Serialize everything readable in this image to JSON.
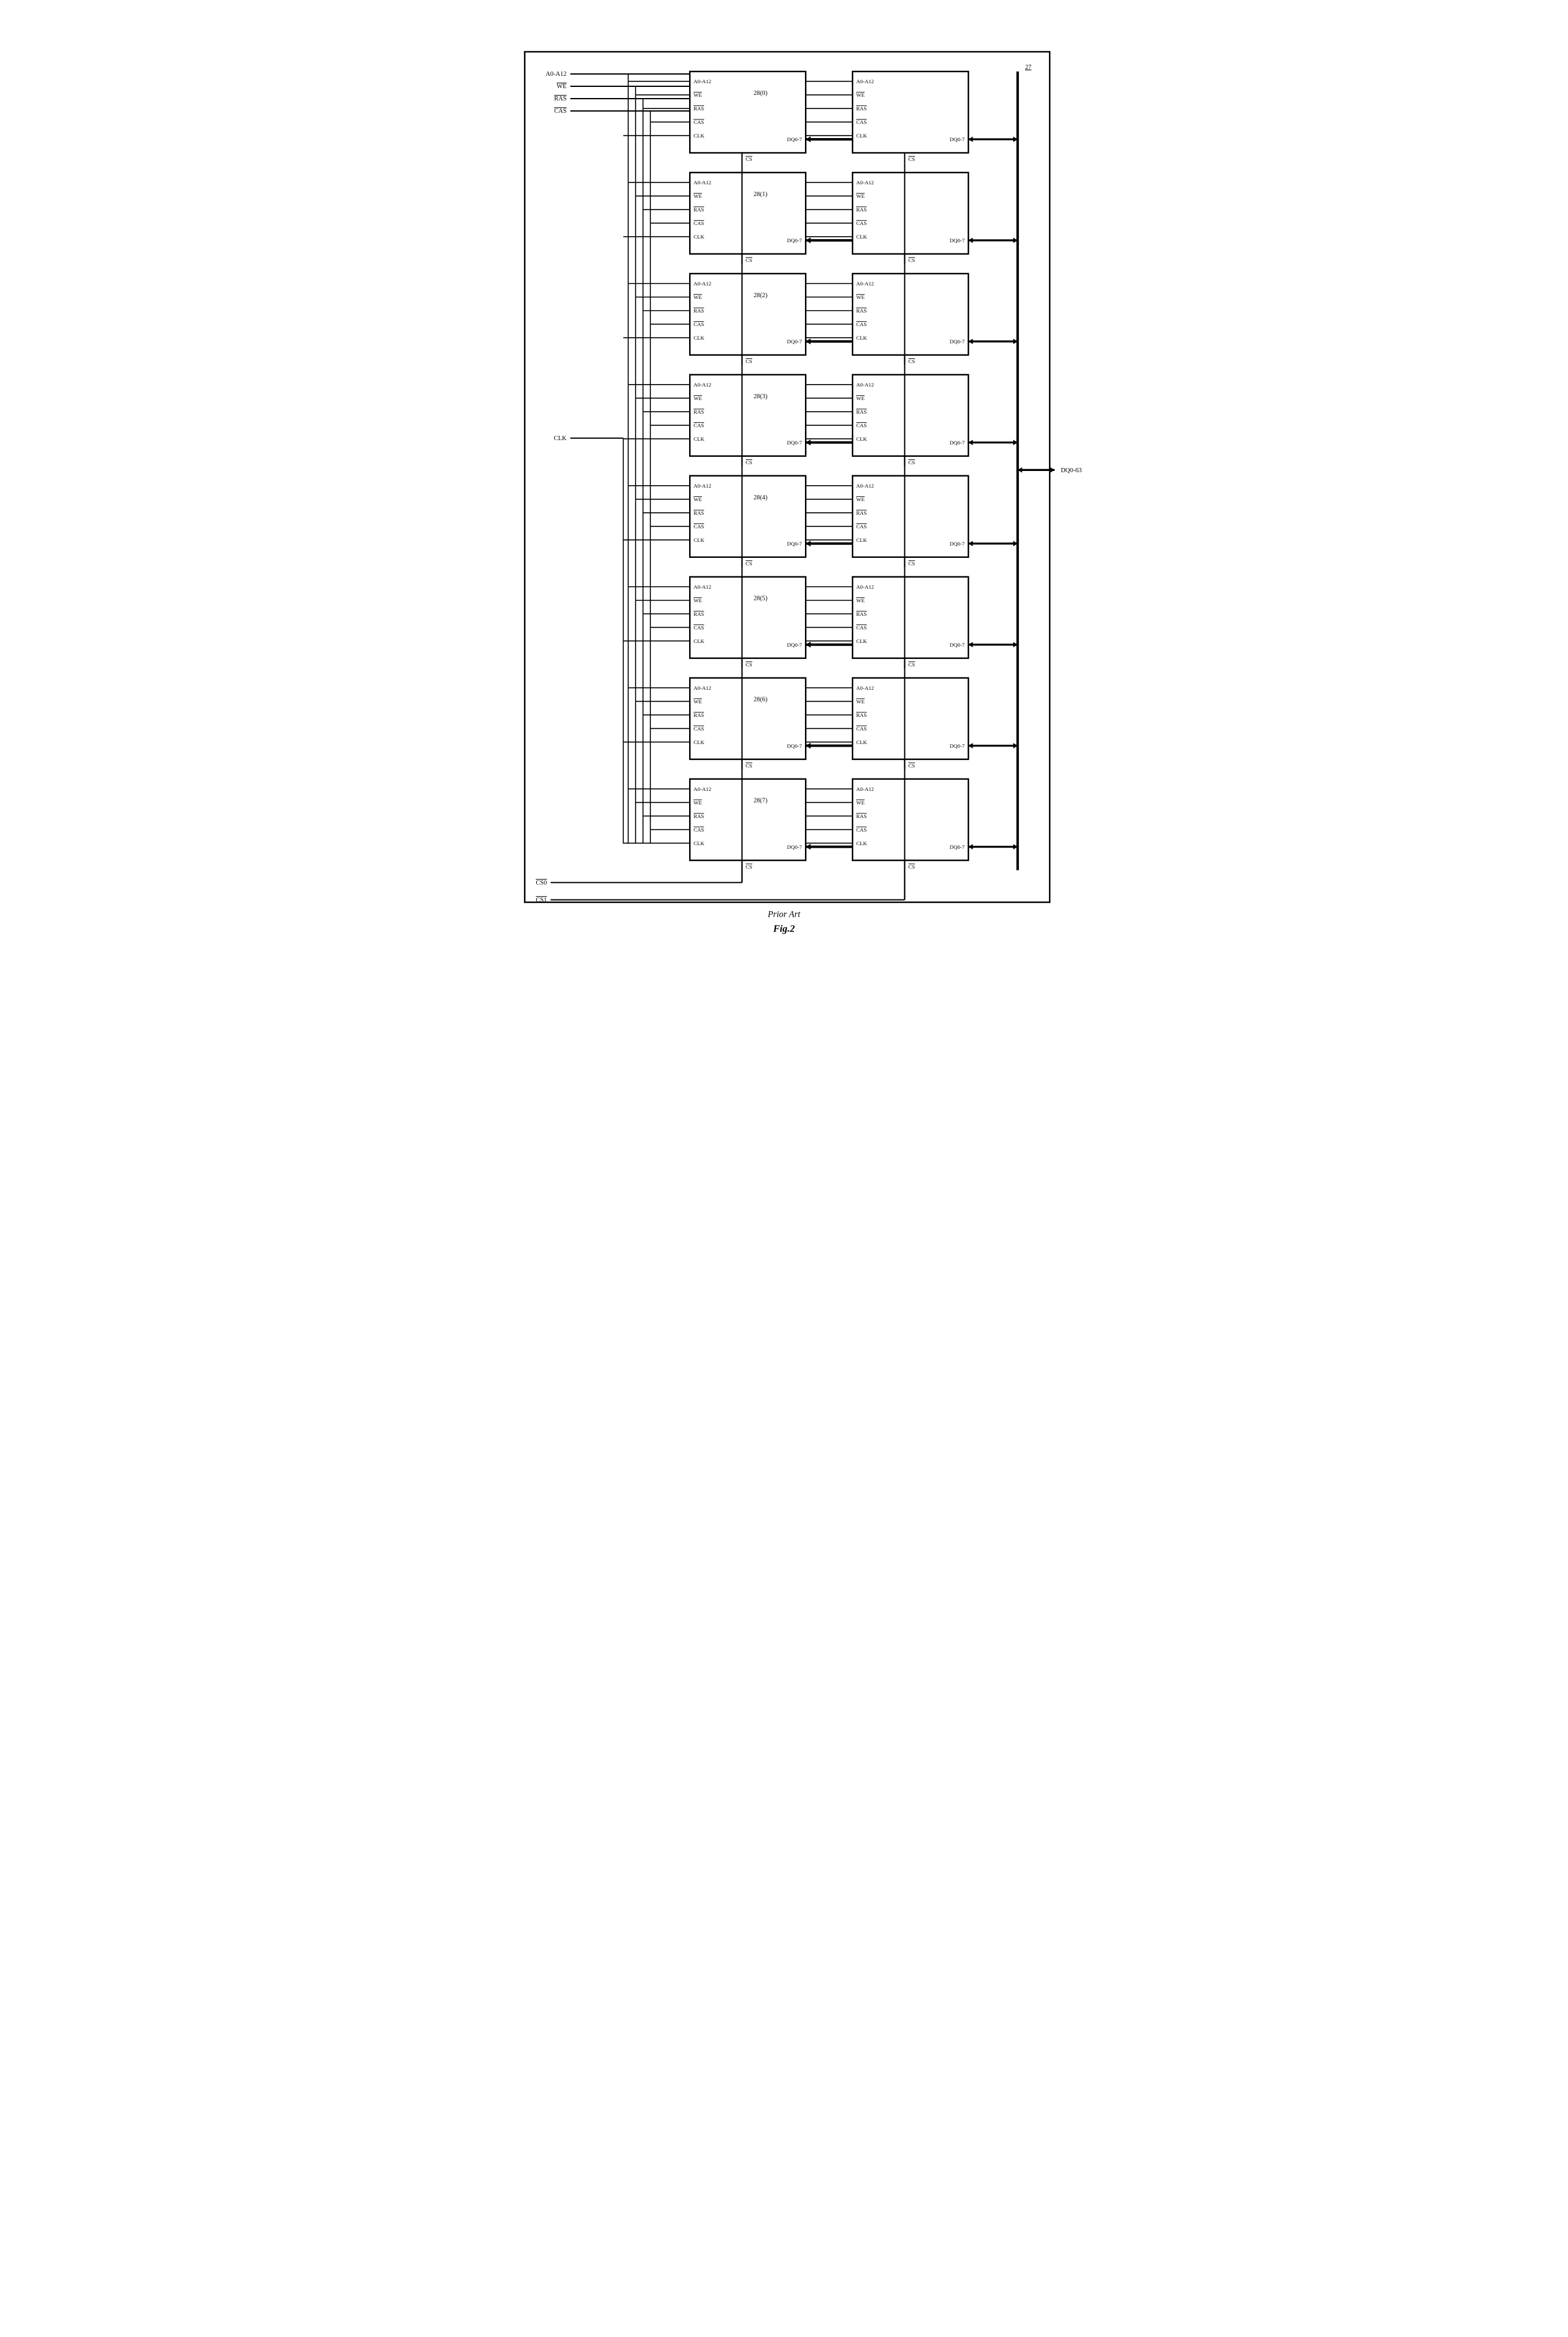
{
  "ref": "27",
  "external_labels": {
    "addr": "A0-A12",
    "we": "WE",
    "ras": "RAS",
    "cas": "CAS",
    "clk": "CLK",
    "cs0": "CS0",
    "cs1": "CS1",
    "dq": "DQ0-63"
  },
  "chip_labels": {
    "addr": "A0-A12",
    "we": "WE",
    "ras": "RAS",
    "cas": "CAS",
    "clk": "CLK",
    "cs": "CS",
    "dq": "DQ0-7"
  },
  "chip_ids": [
    "28(0)",
    "28(1)",
    "28(2)",
    "28(3)",
    "28(4)",
    "28(5)",
    "28(6)",
    "28(7)"
  ],
  "caption1": "Prior Art",
  "caption2": "Fig.2"
}
